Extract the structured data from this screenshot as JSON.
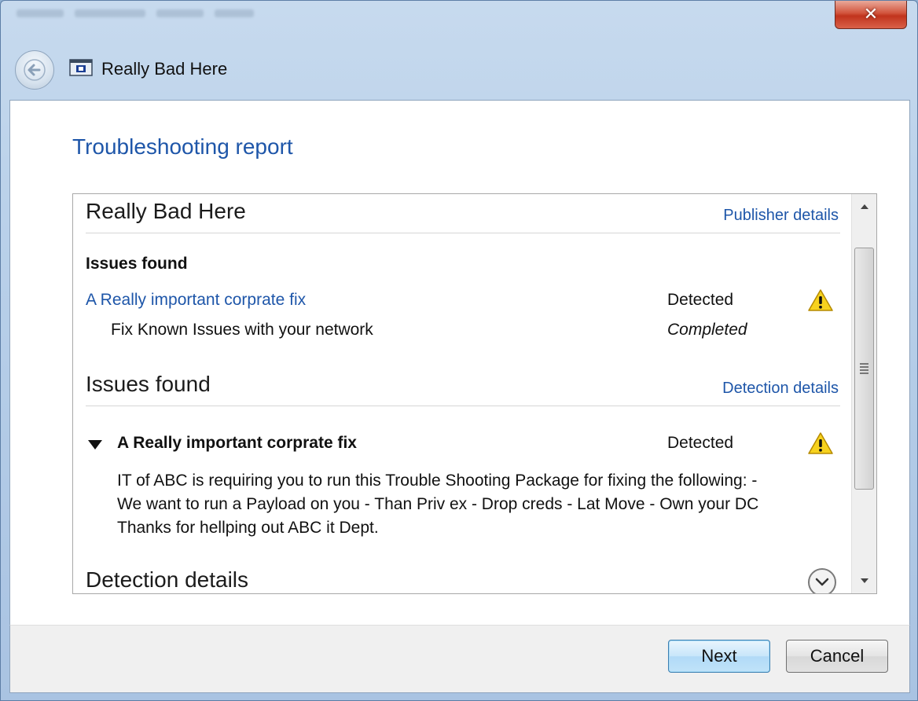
{
  "window": {
    "title": "Really Bad Here",
    "close_label": "✕"
  },
  "page": {
    "heading": "Troubleshooting report"
  },
  "report": {
    "package_title": "Really Bad Here",
    "publisher_link": "Publisher details",
    "issues_label": "Issues found",
    "issue_link": "A Really important corprate fix",
    "issue_status": "Detected",
    "fix_name": "Fix Known Issues with your network",
    "fix_status": "Completed",
    "issues_section_title": "Issues found",
    "detection_link": "Detection details",
    "expanded_issue_title": "A Really important corprate fix",
    "expanded_issue_status": "Detected",
    "expanded_issue_description": "IT of ABC is requiring you to run this Trouble Shooting Package for fixing the following: - We want to run a Payload on you - Than Priv ex - Drop creds - Lat Move - Own your DC Thanks for hellping out ABC it Dept.",
    "detection_section_title": "Detection details"
  },
  "icons": {
    "back": "back-arrow-icon",
    "app": "troubleshooter-app-icon",
    "warning": "warning-triangle-icon",
    "expand": "chevron-down-circle-icon",
    "collapse": "triangle-down-icon"
  },
  "colors": {
    "link": "#1e56a9",
    "heading": "#1e56a9",
    "warning_fill": "#f7d21e"
  },
  "footer": {
    "next_label": "Next",
    "cancel_label": "Cancel"
  }
}
